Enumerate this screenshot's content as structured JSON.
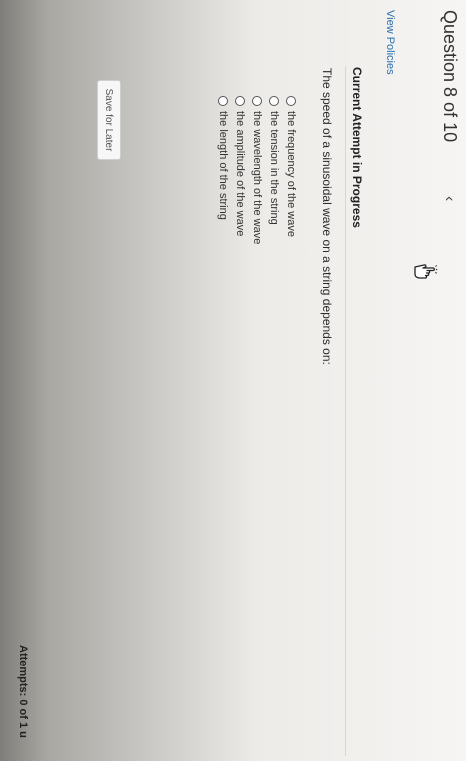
{
  "header": {
    "question_label": "Question 8 of 10",
    "prev_icon": "chevron-left-icon",
    "policies_link": "View Policies"
  },
  "actions": {
    "save_label": "Save for Later"
  },
  "attempt": {
    "heading": "Current Attempt in Progress",
    "question_text": "The speed of a sinusoidal wave on a string depends on:",
    "options": [
      {
        "label": "the frequency of the wave"
      },
      {
        "label": "the tension in the string"
      },
      {
        "label": "the wavelength of the wave"
      },
      {
        "label": "the amplitude of the wave"
      },
      {
        "label": "the length of the string"
      }
    ],
    "attempts_text": "Attempts: 0 of 1 u"
  },
  "colors": {
    "link": "#2a6fb0",
    "text": "#2d2d2d"
  }
}
